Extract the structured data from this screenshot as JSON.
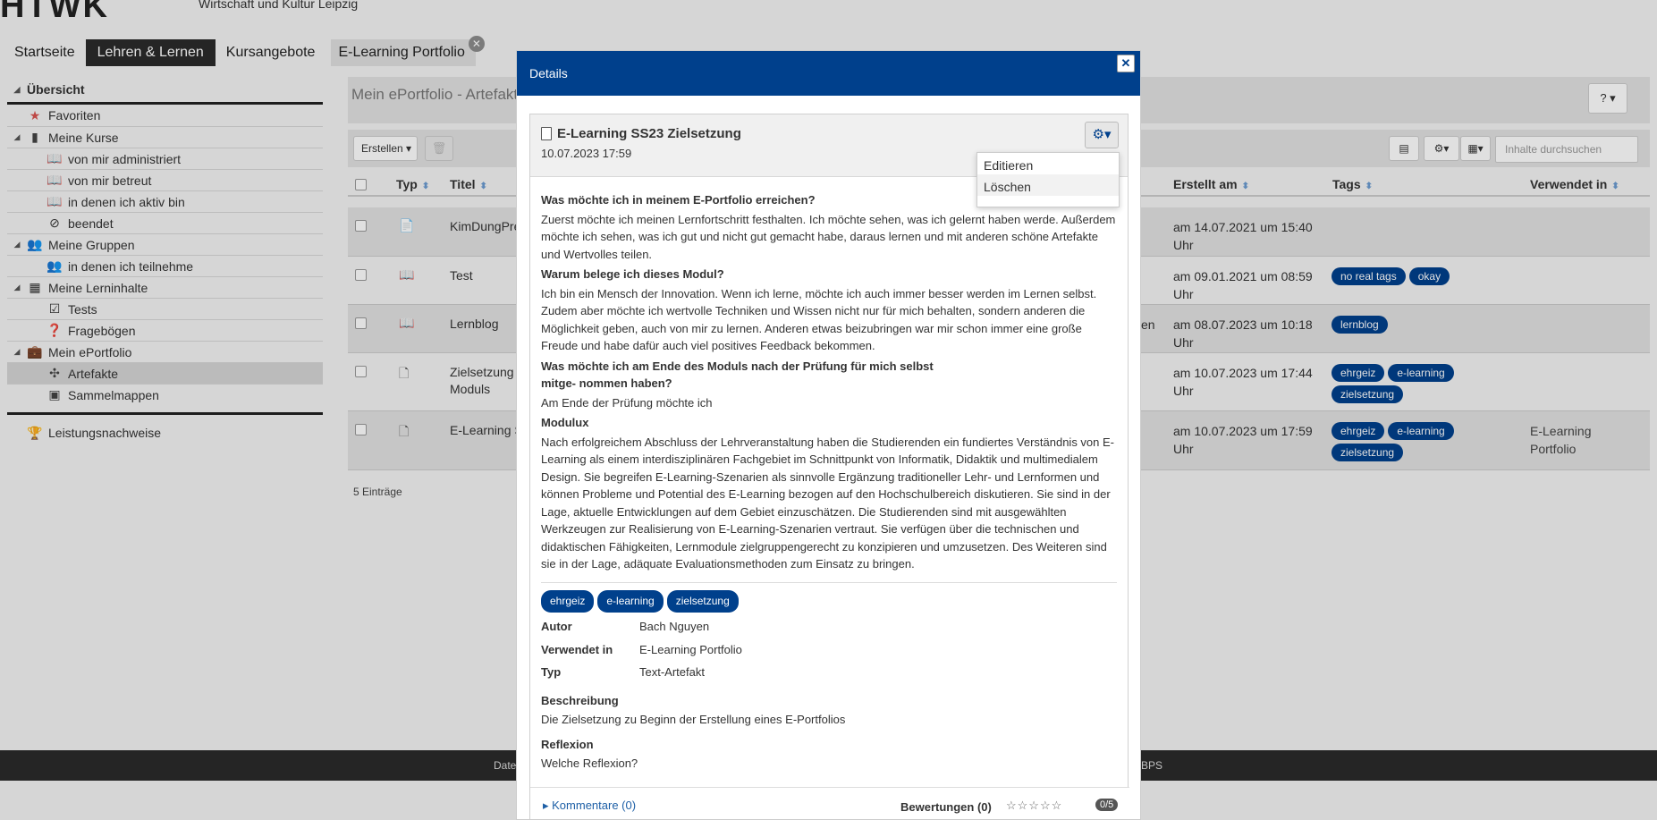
{
  "header": {
    "logo": "HTWK",
    "subtitle": "Wirtschaft und Kultur Leipzig"
  },
  "topnav": [
    "Startseite",
    "Lehren & Lernen",
    "Kursangebote",
    "E-Learning Portfolio"
  ],
  "sidebar": {
    "head": "Übersicht",
    "items": [
      {
        "label": "Favoriten",
        "level": 1,
        "icon": "star-icon"
      },
      {
        "label": "Meine Kurse",
        "level": 1,
        "icon": "book-icon",
        "tri": true
      },
      {
        "label": "von mir administriert",
        "level": 2,
        "icon": "open-book-icon"
      },
      {
        "label": "von mir betreut",
        "level": 2,
        "icon": "open-book-icon"
      },
      {
        "label": "in denen ich aktiv bin",
        "level": 2,
        "icon": "open-book-icon"
      },
      {
        "label": "beendet",
        "level": 2,
        "icon": "ban-icon"
      },
      {
        "label": "Meine Gruppen",
        "level": 1,
        "icon": "group-icon",
        "tri": true
      },
      {
        "label": "in denen ich teilnehme",
        "level": 2,
        "icon": "group-icon"
      },
      {
        "label": "Meine Lerninhalte",
        "level": 1,
        "icon": "grid-icon",
        "tri": true
      },
      {
        "label": "Tests",
        "level": 2,
        "icon": "checkbox-icon"
      },
      {
        "label": "Fragebögen",
        "level": 2,
        "icon": "question-icon"
      },
      {
        "label": "Mein ePortfolio",
        "level": 1,
        "icon": "briefcase-icon",
        "tri": true
      },
      {
        "label": "Artefakte",
        "level": 2,
        "icon": "puzzle-icon",
        "selected": true
      },
      {
        "label": "Sammelmappen",
        "level": 2,
        "icon": "binder-icon"
      }
    ],
    "bottom": "Leistungsnachweise"
  },
  "main": {
    "title": "Mein ePortfolio - Artefakte",
    "create_label": "Erstellen",
    "search_placeholder": "Inhalte durchsuchen",
    "columns": {
      "typ": "Typ",
      "titel": "Titel",
      "erstellt": "Erstellt am",
      "tags": "Tags",
      "verwendet": "Verwendet in"
    },
    "rows": [
      {
        "title": "KimDungPre",
        "date": "am 14.07.2021 um 15:40 Uhr",
        "tags": [],
        "used": "",
        "frag": ""
      },
      {
        "title": "Test",
        "date": "am 09.01.2021 um 08:59 Uhr",
        "tags": [
          "no real tags",
          "okay"
        ],
        "used": "",
        "frag": ""
      },
      {
        "title": "Lernblog",
        "date": "am 08.07.2023 um 10:18 Uhr",
        "tags": [
          "lernblog"
        ],
        "used": "",
        "frag": "en"
      },
      {
        "title": "Zielsetzung",
        "title2": "Moduls",
        "date": "am 10.07.2023 um 17:44 Uhr",
        "tags": [
          "ehrgeiz",
          "e-learning",
          "zielsetzung"
        ],
        "used": "",
        "frag": ""
      },
      {
        "title": "E-Learning S",
        "date": "am 10.07.2023 um 17:59 Uhr",
        "tags": [
          "ehrgeiz",
          "e-learning",
          "zielsetzung"
        ],
        "used": "E-Learning Portfolio",
        "frag": ""
      }
    ],
    "count": "5 Einträge"
  },
  "footer": {
    "left": "Date",
    "right": "BPS"
  },
  "modal": {
    "title": "Details",
    "card_title": "E-Learning SS23 Zielsetzung",
    "card_date": "10.07.2023 17:59",
    "menu": [
      "Editieren",
      "Löschen"
    ],
    "q1": "Was möchte ich in meinem E-Portfolio erreichen?",
    "a1": "Zuerst möchte ich meinen Lernfortschritt festhalten. Ich möchte sehen, was ich gelernt haben werde. Außerdem möchte ich sehen, was ich gut und nicht gut gemacht habe, daraus lernen und mit anderen schöne Artefakte und Wertvolles teilen.",
    "q2": "Warum belege ich dieses Modul?",
    "a2": "Ich bin ein Mensch der Innovation. Wenn ich lerne, möchte ich auch immer besser werden im Lernen selbst. Zudem aber möchte ich wertvolle Techniken und Wissen nicht nur für mich behalten, sondern anderen die Möglichkeit geben, auch von mir zu lernen. Anderen etwas beizubringen war mir schon immer eine große Freude und habe dafür auch viel positives Feedback bekommen.",
    "q3": "Was möchte ich am Ende des Moduls nach der Prüfung für mich selbst mitge- nommen haben?",
    "a3": "Am Ende der Prüfung möchte ich",
    "q4": "Modulux",
    "a4": "Nach erfolgreichem Abschluss der Lehrveranstaltung haben die Studierenden ein fundiertes Verständnis von E-Learning als einem interdisziplinären Fachgebiet im Schnittpunkt von Informatik, Didaktik und multimedialem Design. Sie begreifen E-Learning-Szenarien als sinnvolle Ergänzung traditioneller Lehr- und Lernformen und können Probleme und Potential des E-Learning bezogen auf den Hochschulbereich diskutieren. Sie sind in der Lage, aktuelle Entwicklungen auf dem Gebiet einzuschätzen. Die Studierenden sind mit ausgewählten Werkzeugen zur Realisierung von E-Learning-Szenarien vertraut. Sie verfügen über die technischen und didaktischen Fähigkeiten, Lernmodule zielgruppengerecht zu konzipieren und umzusetzen. Des Weiteren sind sie in der Lage, adäquate Evaluationsmethoden zum Einsatz zu bringen.",
    "tags": [
      "ehrgeiz",
      "e-learning",
      "zielsetzung"
    ],
    "meta": [
      {
        "k": "Autor",
        "v": "Bach Nguyen"
      },
      {
        "k": "Verwendet in",
        "v": "E-Learning Portfolio"
      },
      {
        "k": "Typ",
        "v": "Text-Artefakt"
      }
    ],
    "beschreibung_label": "Beschreibung",
    "beschreibung": "Die Zielsetzung zu Beginn der Erstellung eines E-Portfolios",
    "reflexion_label": "Reflexion",
    "reflexion": "Welche Reflexion?",
    "kommentare": "Kommentare (0)",
    "bewertungen": "Bewertungen (0)",
    "score": "0/5"
  },
  "colors": {
    "primary": "#00408c",
    "nav_active": "#2b2b2b"
  }
}
